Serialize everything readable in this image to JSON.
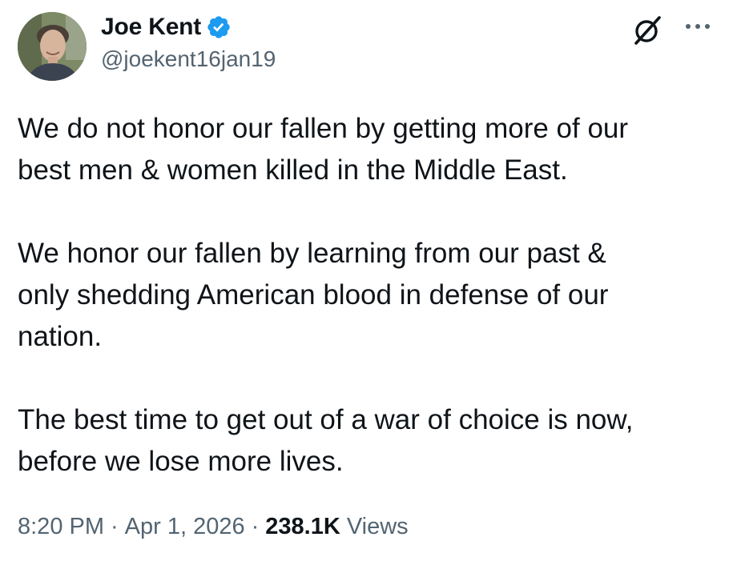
{
  "author": {
    "display_name": "Joe Kent",
    "handle": "@joekent16jan19",
    "verified_icon": "verified-badge-icon",
    "avatar": "avatar"
  },
  "header_icons": {
    "grok": "grok-icon",
    "more": "more-icon"
  },
  "colors": {
    "text": "#0f1419",
    "secondary": "#536471",
    "verified_blue": "#1d9bf0"
  },
  "body": {
    "paragraphs": [
      "We do not honor our fallen by getting more of our\nbest men & women killed in the Middle East.",
      "We honor our fallen by learning from our past &\nonly shedding American blood in defense of our\nnation.",
      "The best time to get out of a war of choice is now,\nbefore we lose more lives."
    ]
  },
  "meta": {
    "time": "8:20 PM",
    "separator": "·",
    "date": "Apr 1, 2026",
    "views_count": "238.1K",
    "views_label": "Views"
  }
}
